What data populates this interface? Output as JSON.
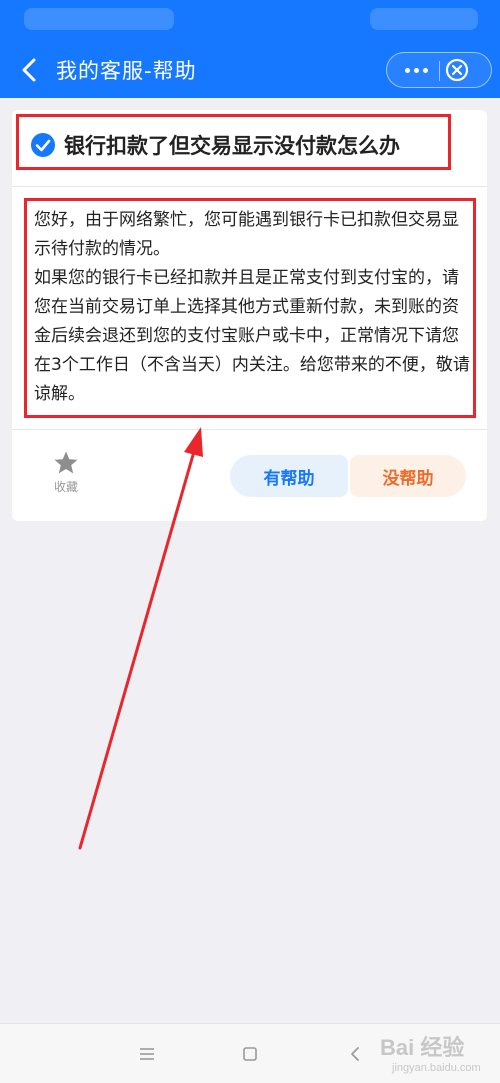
{
  "header": {
    "title": "我的客服-帮助"
  },
  "question": {
    "title": "银行扣款了但交易显示没付款怎么办"
  },
  "answer": {
    "paragraphs": [
      "您好，由于网络繁忙，您可能遇到银行卡已扣款但交易显示待付款的情况。",
      "如果您的银行卡已经扣款并且是正常支付到支付宝的，请您在当前交易订单上选择其他方式重新付款，未到账的资金后续会退还到您的支付宝账户或卡中，正常情况下请您在3个工作日（不含当天）内关注。给您带来的不便，敬请谅解。"
    ]
  },
  "actions": {
    "favorite_label": "收藏",
    "helpful_label": "有帮助",
    "unhelpful_label": "没帮助"
  },
  "watermark": {
    "brand": "Bai 经验",
    "url": "jingyan.baidu.com"
  },
  "colors": {
    "brand_blue": "#1677ff",
    "annotation_red": "#e8262b",
    "unhelpful_orange": "#f06a2b"
  }
}
